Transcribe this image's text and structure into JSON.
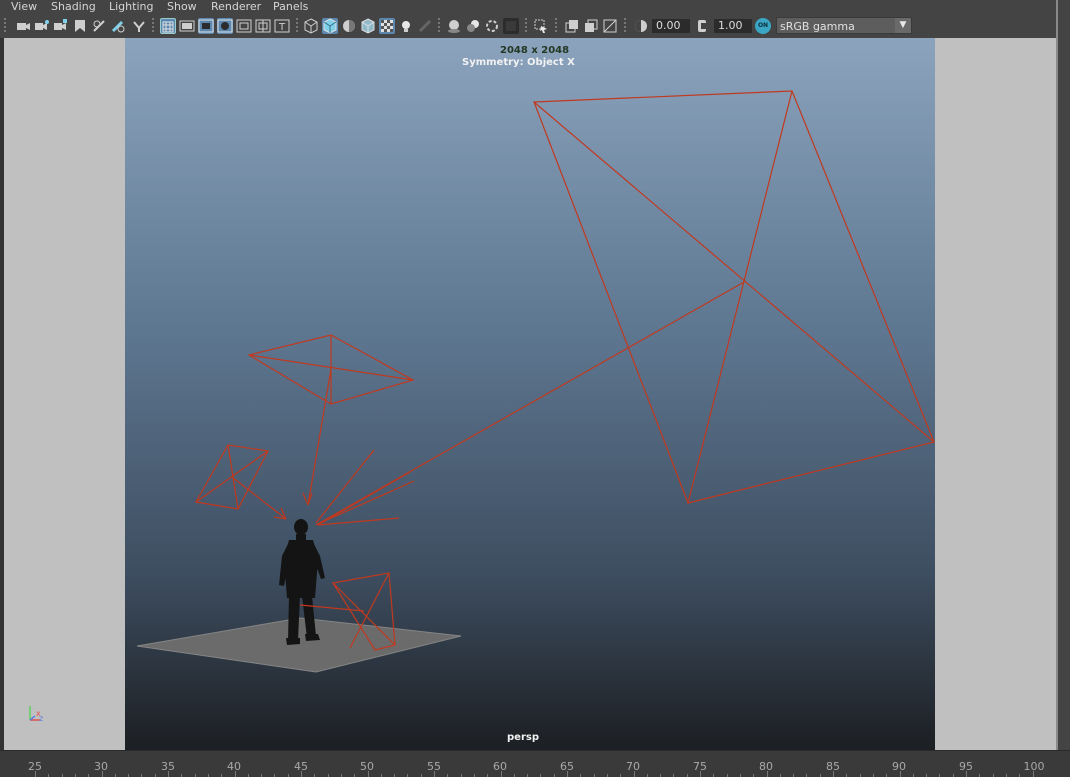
{
  "menu": [
    "View",
    "Shading",
    "Lighting",
    "Show",
    "Renderer",
    "Panels"
  ],
  "toolbar": {
    "exposure": "0.00",
    "gamma_value": "1.00",
    "color_space": "sRGB gamma",
    "on_badge": "ON"
  },
  "viewport": {
    "resolution": "2048 x 2048",
    "symmetry": "Symmetry: Object X",
    "camera": "persp",
    "axis_x": "x",
    "axis_z": "z"
  },
  "timeline": {
    "ticks": [
      "25",
      "30",
      "35",
      "40",
      "45",
      "50",
      "55",
      "60",
      "65",
      "70",
      "75",
      "80",
      "85",
      "90",
      "95",
      "100"
    ]
  },
  "colors": {
    "light_wire": "#c0391f",
    "viewport_bg_top": "#8ba3bd",
    "viewport_bg_bottom": "#1c1f23",
    "ground_plane": "#6b6b6b",
    "hud_resolution": "#233823"
  }
}
